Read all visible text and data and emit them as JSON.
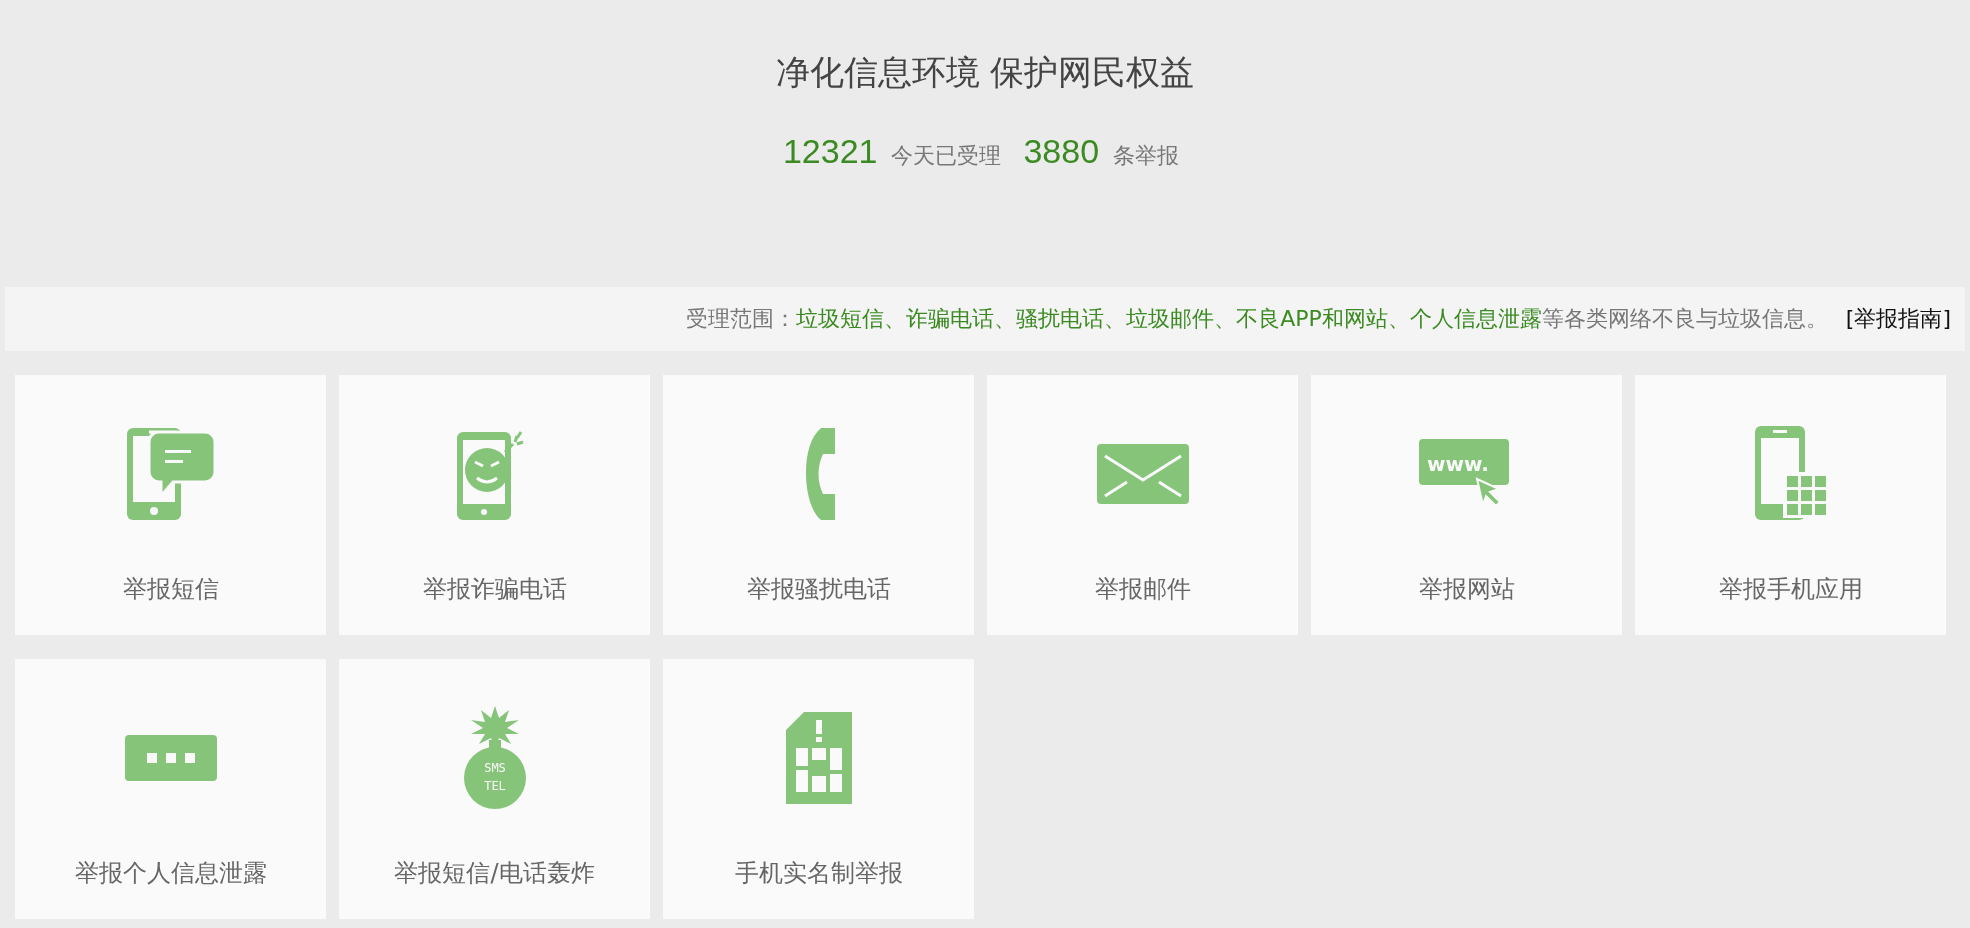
{
  "header": {
    "title": "净化信息环境 保护网民权益",
    "stats": [
      {
        "number": "12321",
        "caption": "今天已受理"
      },
      {
        "number": "3880",
        "caption": "条举报"
      }
    ]
  },
  "scope": {
    "parts": [
      {
        "text": "受理范围：",
        "highlighted": false
      },
      {
        "text": "垃圾短信、诈骗电话、骚扰电话、垃圾邮件、不良APP和网站、个人信息泄露",
        "highlighted": true
      },
      {
        "text": "等各类网络不良与垃圾信息。",
        "highlighted": false
      }
    ],
    "link": "[举报指南]"
  },
  "cards": [
    {
      "kind": "sms",
      "label": "举报短信"
    },
    {
      "kind": "fraud",
      "label": "举报诈骗电话"
    },
    {
      "kind": "phone",
      "label": "举报骚扰电话"
    },
    {
      "kind": "mail",
      "label": "举报邮件"
    },
    {
      "kind": "web",
      "label": "举报网站",
      "icon_text": [
        "www."
      ]
    },
    {
      "kind": "app",
      "label": "举报手机应用"
    },
    {
      "kind": "dots",
      "label": "举报个人信息泄露"
    },
    {
      "kind": "bomb",
      "label": "举报短信/电话轰炸",
      "icon_text": [
        "SMS",
        "TEL"
      ]
    },
    {
      "kind": "sim",
      "label": "手机实名制举报"
    }
  ]
}
